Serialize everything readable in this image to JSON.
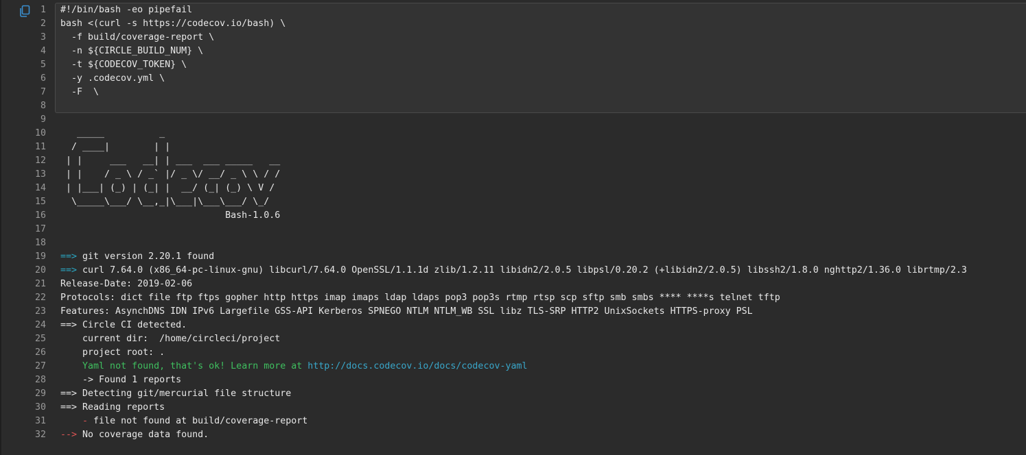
{
  "app": {
    "copy_icon": "copy-icon"
  },
  "lines": [
    {
      "n": "1",
      "parts": [
        {
          "t": "#!/bin/bash -eo pipefail"
        }
      ]
    },
    {
      "n": "2",
      "parts": [
        {
          "t": "bash <(curl -s https://codecov.io/bash) \\"
        }
      ]
    },
    {
      "n": "3",
      "parts": [
        {
          "t": "  -f build/coverage-report \\"
        }
      ]
    },
    {
      "n": "4",
      "parts": [
        {
          "t": "  -n ${CIRCLE_BUILD_NUM} \\"
        }
      ]
    },
    {
      "n": "5",
      "parts": [
        {
          "t": "  -t ${CODECOV_TOKEN} \\"
        }
      ]
    },
    {
      "n": "6",
      "parts": [
        {
          "t": "  -y .codecov.yml \\"
        }
      ]
    },
    {
      "n": "7",
      "parts": [
        {
          "t": "  -F  \\"
        }
      ]
    },
    {
      "n": "8",
      "parts": [
        {
          "t": ""
        }
      ]
    },
    {
      "n": "9",
      "parts": [
        {
          "t": ""
        }
      ]
    },
    {
      "n": "10",
      "parts": [
        {
          "t": "   _____          _"
        }
      ]
    },
    {
      "n": "11",
      "parts": [
        {
          "t": "  / ____|        | |"
        }
      ]
    },
    {
      "n": "12",
      "parts": [
        {
          "t": " | |     ___   __| | ___  ___ _____   __"
        }
      ]
    },
    {
      "n": "13",
      "parts": [
        {
          "t": " | |    / _ \\ / _` |/ _ \\/ __/ _ \\ \\ / /"
        }
      ]
    },
    {
      "n": "14",
      "parts": [
        {
          "t": " | |___| (_) | (_| |  __/ (_| (_) \\ V /"
        }
      ]
    },
    {
      "n": "15",
      "parts": [
        {
          "t": "  \\_____\\___/ \\__,_|\\___|\\___\\___/ \\_/"
        }
      ]
    },
    {
      "n": "16",
      "parts": [
        {
          "t": "                              Bash-1.0.6"
        }
      ]
    },
    {
      "n": "17",
      "parts": [
        {
          "t": ""
        }
      ]
    },
    {
      "n": "18",
      "parts": [
        {
          "t": ""
        }
      ]
    },
    {
      "n": "19",
      "parts": [
        {
          "t": "==>",
          "c": "arrow-cyan"
        },
        {
          "t": " git version 2.20.1 found"
        }
      ]
    },
    {
      "n": "20",
      "parts": [
        {
          "t": "==>",
          "c": "arrow-cyan"
        },
        {
          "t": " curl 7.64.0 (x86_64-pc-linux-gnu) libcurl/7.64.0 OpenSSL/1.1.1d zlib/1.2.11 libidn2/2.0.5 libpsl/0.20.2 (+libidn2/2.0.5) libssh2/1.8.0 nghttp2/1.36.0 librtmp/2.3"
        }
      ]
    },
    {
      "n": "21",
      "parts": [
        {
          "t": "Release-Date: 2019-02-06"
        }
      ]
    },
    {
      "n": "22",
      "parts": [
        {
          "t": "Protocols: dict file ftp ftps gopher http https imap imaps ldap ldaps pop3 pop3s rtmp rtsp scp sftp smb smbs **** ****s telnet tftp"
        }
      ]
    },
    {
      "n": "23",
      "parts": [
        {
          "t": "Features: AsynchDNS IDN IPv6 Largefile GSS-API Kerberos SPNEGO NTLM NTLM_WB SSL libz TLS-SRP HTTP2 UnixSockets HTTPS-proxy PSL"
        }
      ]
    },
    {
      "n": "24",
      "parts": [
        {
          "t": "==> Circle CI detected."
        }
      ]
    },
    {
      "n": "25",
      "parts": [
        {
          "t": "    current dir:  /home/circleci/project"
        }
      ]
    },
    {
      "n": "26",
      "parts": [
        {
          "t": "    project root: ."
        }
      ]
    },
    {
      "n": "27",
      "parts": [
        {
          "t": "    "
        },
        {
          "t": "Yaml not found, that's ok! Learn more at ",
          "c": "green"
        },
        {
          "t": "http://docs.codecov.io/docs/codecov-yaml",
          "c": "link",
          "link": true
        }
      ]
    },
    {
      "n": "28",
      "parts": [
        {
          "t": "    -> Found 1 reports"
        }
      ]
    },
    {
      "n": "29",
      "parts": [
        {
          "t": "==> Detecting git/mercurial file structure"
        }
      ]
    },
    {
      "n": "30",
      "parts": [
        {
          "t": "==> Reading reports"
        }
      ]
    },
    {
      "n": "31",
      "parts": [
        {
          "t": "    "
        },
        {
          "t": "-",
          "c": "dash-red"
        },
        {
          "t": " file not found at build/coverage-report"
        }
      ]
    },
    {
      "n": "32",
      "parts": [
        {
          "t": "-->",
          "c": "arrow-red"
        },
        {
          "t": " No coverage data found."
        }
      ]
    }
  ]
}
